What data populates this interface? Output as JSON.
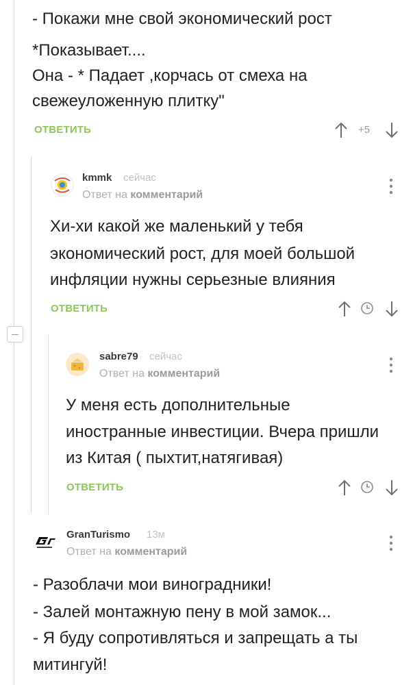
{
  "comments": {
    "c0": {
      "lines": [
        "- Покажи мне свой экономический рост",
        "*Показывает....",
        "Она - * Падает ,корчась от смеха на",
        "свежеуложенную плитку\""
      ],
      "reply_label": "ОТВЕТИТЬ",
      "rating": "+5"
    },
    "c1": {
      "author": "kmmk",
      "time": "сейчас",
      "reply_to_prefix": "Ответ на",
      "reply_to_link": "комментарий",
      "lines": [
        "Хи-хи какой же маленький у тебя",
        "экономический рост, для моей большой",
        "инфляции нужны серьезные влияния"
      ],
      "reply_label": "ОТВЕТИТЬ"
    },
    "c2": {
      "author": "sabre79",
      "time": "сейчас",
      "reply_to_prefix": "Ответ на",
      "reply_to_link": "комментарий",
      "lines": [
        "У меня есть дополнительные",
        "иностранные инвестиции. Вчера пришли",
        "из Китая ( пыхтит,натягивая)"
      ],
      "reply_label": "ОТВЕТИТЬ"
    },
    "c3": {
      "author": "GranTurismo",
      "time": "13м",
      "reply_to_prefix": "Ответ на",
      "reply_to_link": "комментарий",
      "lines": [
        "- Разоблачи мои виноградники!",
        "- Залей монтажную пену в мой замок...",
        "- Я буду сопротивляться и запрещать а ты",
        "митингуй!"
      ]
    }
  },
  "colors": {
    "reply_green": "#8ac858",
    "muted": "#9a9a9a",
    "text": "#222222"
  },
  "icons": {
    "vote_up": "arrow-up-icon",
    "vote_down": "arrow-down-icon",
    "pending": "clock-icon",
    "menu": "more-vertical-icon"
  }
}
